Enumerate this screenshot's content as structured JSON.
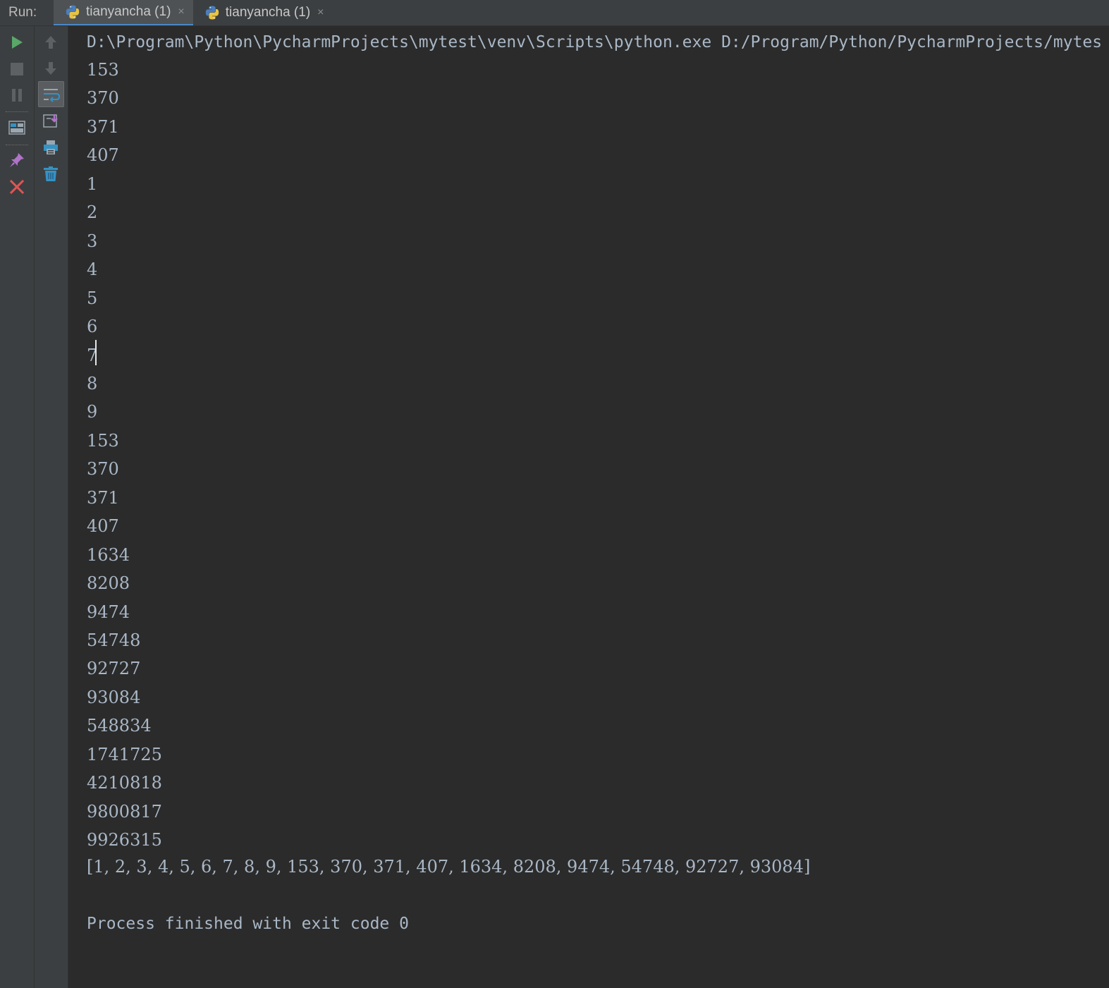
{
  "run_bar": {
    "label": "Run:",
    "tabs": [
      {
        "label": "tianyancha (1)"
      },
      {
        "label": "tianyancha (1)"
      }
    ],
    "close_glyph": "×"
  },
  "toolbar": {
    "left": [
      "run-icon",
      "stop-icon",
      "pause-icon",
      "restore-layout-icon",
      "pin-icon",
      "close-icon"
    ],
    "right": [
      "scroll-up-icon",
      "scroll-down-icon",
      "soft-wrap-icon",
      "scroll-to-end-icon",
      "print-icon",
      "trash-icon"
    ]
  },
  "console": {
    "command": "D:\\Program\\Python\\PycharmProjects\\mytest\\venv\\Scripts\\python.exe D:/Program/Python/PycharmProjects/mytes",
    "output_lines": [
      "153",
      "370",
      "371",
      "407",
      "1",
      "2",
      "3",
      "4",
      "5",
      "6",
      "7",
      "8",
      "9",
      "153",
      "370",
      "371",
      "407",
      "1634",
      "8208",
      "9474",
      "54748",
      "92727",
      "93084",
      "548834",
      "1741725",
      "4210818",
      "9800817",
      "9926315"
    ],
    "result_list": "[1, 2, 3, 4, 5, 6, 7, 8, 9, 153, 370, 371, 407, 1634, 8208, 9474, 54748, 92727, 93084]",
    "exit_message": "Process finished with exit code 0"
  },
  "colors": {
    "background": "#2b2b2b",
    "text": "#a9b7c6",
    "toolbar": "#3c3f41",
    "run_green": "#59a869",
    "close_red": "#e05555"
  }
}
